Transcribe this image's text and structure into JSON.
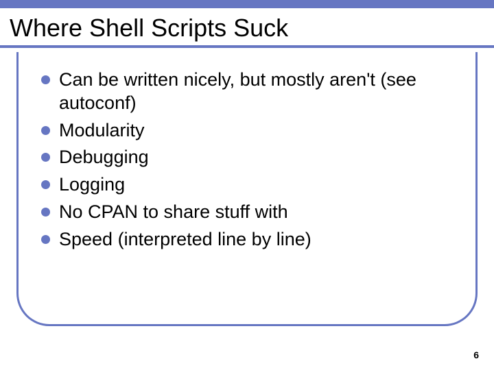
{
  "slide": {
    "title": "Where Shell Scripts Suck",
    "bullets": [
      "Can be written nicely, but mostly aren't (see autoconf)",
      "Modularity",
      "Debugging",
      "Logging",
      "No CPAN to share stuff with",
      "Speed (interpreted line by line)"
    ],
    "pageNumber": "6"
  },
  "colors": {
    "accent": "#6676c2"
  }
}
